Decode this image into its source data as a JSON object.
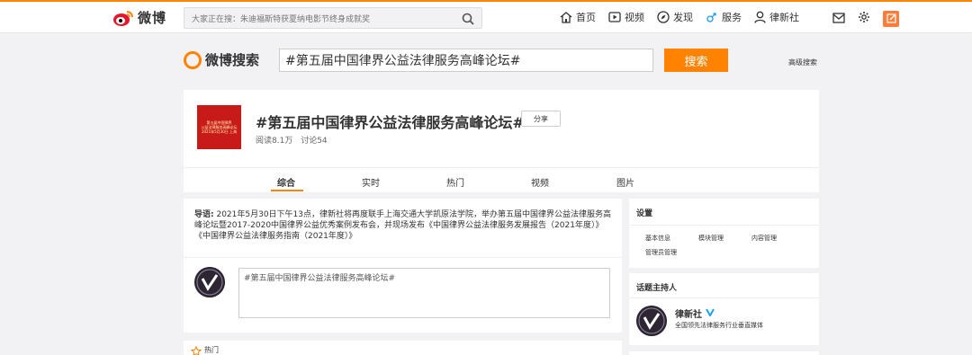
{
  "nav": {
    "logo_text": "微博",
    "search_placeholder": "大家正在搜：朱迪福斯特获夏纳电影节终身成就奖",
    "links": [
      {
        "label": "首页",
        "icon": "home-icon"
      },
      {
        "label": "视频",
        "icon": "video-icon"
      },
      {
        "label": "发现",
        "icon": "compass-icon"
      },
      {
        "label": "服务",
        "icon": "service-icon"
      },
      {
        "label": "律新社",
        "icon": "user-icon"
      }
    ]
  },
  "search": {
    "logo_text": "微博搜索",
    "query": "#第五届中国律界公益法律服务高峰论坛#",
    "button_label": "搜索",
    "advanced_label": "高级搜索"
  },
  "topic": {
    "title": "#第五届中国律界公益法律服务高峰论坛#",
    "share_label": "分享",
    "reads": "阅读8.1万",
    "discussions": "讨论54",
    "image_lines": [
      "第五届中国律界",
      "公益法律服务高峰论坛",
      "2021年5月30日 上海"
    ],
    "tabs": [
      "综合",
      "实时",
      "热门",
      "视频",
      "图片"
    ]
  },
  "intro": {
    "label": "导语:",
    "text": " 2021年5月30日下午13点，律新社将再度联手上海交通大学凯原法学院，举办第五届中国律界公益法律服务高峰论坛暨2017-2020中国律界公益优秀案例发布会，并现场发布《中国律界公益法律服务发展报告（2021年度）》《中国律界公益法律服务指南（2021年度）》"
  },
  "comment": {
    "placeholder": "#第五届中国律界公益法律服务高峰论坛#"
  },
  "hot": {
    "label": "热门"
  },
  "settings": {
    "title": "设置",
    "items": [
      "基本信息",
      "模块管理",
      "内容管理",
      "管理员管理"
    ]
  },
  "host": {
    "title": "话题主持人",
    "name": "律新社",
    "description": "全国领先法律服务行业垂直媒体"
  },
  "colors": {
    "accent": "#ff8200",
    "compose": "#fa7d3c",
    "verified": "#1da1f2",
    "topic_image": "#c91a1a"
  }
}
